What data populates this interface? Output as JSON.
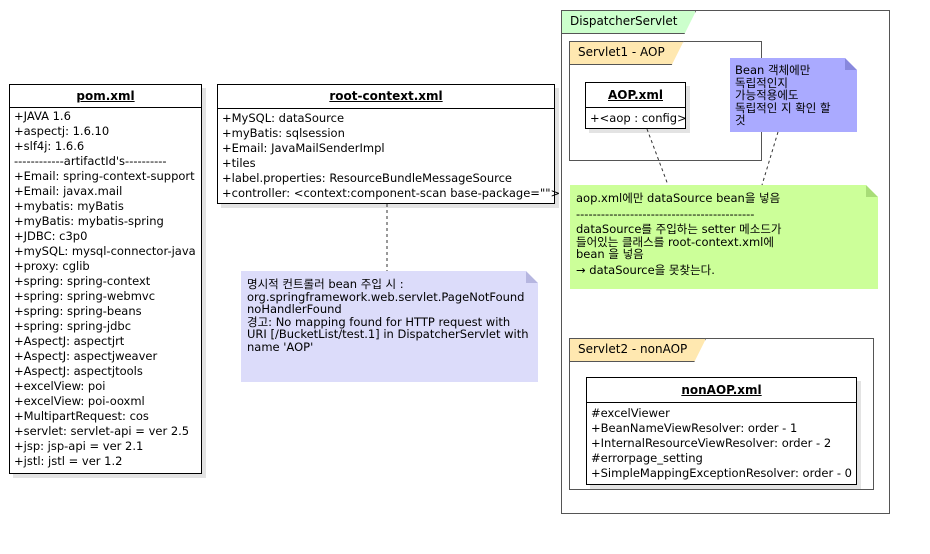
{
  "pom": {
    "title": "pom.xml",
    "items": [
      "+JAVA 1.6",
      "+aspectj: 1.6.10",
      "+slf4j: 1.6.6",
      "------------artifactId's----------",
      "+Email: spring-context-support",
      "+Email: javax.mail",
      "+mybatis: myBatis",
      "+myBatis: mybatis-spring",
      "+JDBC: c3p0",
      "+mySQL: mysql-connector-java",
      "+proxy: cglib",
      "+spring: spring-context",
      "+spring: spring-webmvc",
      "+spring: spring-beans",
      "+spring: spring-jdbc",
      "+AspectJ: aspectjrt",
      "+AspectJ: aspectjweaver",
      "+AspectJ: aspectjtools",
      "+excelView: poi",
      "+excelView: poi-ooxml",
      "+MultipartRequest: cos",
      "+servlet: servlet-api = ver 2.5",
      "+jsp: jsp-api = ver 2.1",
      "+jstl: jstl = ver 1.2"
    ]
  },
  "root_context": {
    "title": "root-context.xml",
    "items": [
      "+MySQL: dataSource",
      "+myBatis: sqlsession",
      "+Email: JavaMailSenderImpl",
      "+tiles",
      "+label.properties: ResourceBundleMessageSource",
      "+controller: <context:component-scan base-package=\"\">"
    ]
  },
  "note_controller": {
    "lines": [
      "명시적 컨트롤러 bean 주입 시 :",
      "org.springframework.web.servlet.PageNotFound",
      "noHandlerFound",
      "경고: No mapping found for HTTP request with",
      "URI [/BucketList/test.1] in DispatcherServlet with",
      "name 'AOP'"
    ]
  },
  "dispatcher": {
    "label": "DispatcherServlet"
  },
  "servlet1": {
    "label": "Servlet1 - AOP"
  },
  "aop": {
    "title": "AOP.xml",
    "items": [
      "+<aop : config>"
    ]
  },
  "note_bean": {
    "lines": [
      "Bean 객체에만",
      "독립적인지",
      "가능적용에도",
      "독립적인 지 확인 할",
      "것"
    ]
  },
  "note_datasource": {
    "lines": [
      "aop.xml에만 dataSource bean을 넣음",
      "-------------------------------------------",
      "dataSource를 주입하는 setter 메소드가",
      "들어있는 클래스를 root-context.xml에",
      "bean 을 넣음",
      "→ dataSource을 못찾는다."
    ]
  },
  "servlet2": {
    "label": "Servlet2 - nonAOP"
  },
  "nonaop": {
    "title": "nonAOP.xml",
    "items": [
      "#excelViewer",
      "+BeanNameViewResolver: order - 1",
      "+InternalResourceViewResolver: order - 2",
      "#errorpage_setting",
      "+SimpleMappingExceptionResolver: order - 0"
    ]
  },
  "colors": {
    "dispatcher_tab": "#ccffcc",
    "servlet_tab": "#ffe8b0",
    "note_purple": "#dcdcfa",
    "note_blue": "#aaaaff",
    "note_green": "#ccff99"
  }
}
